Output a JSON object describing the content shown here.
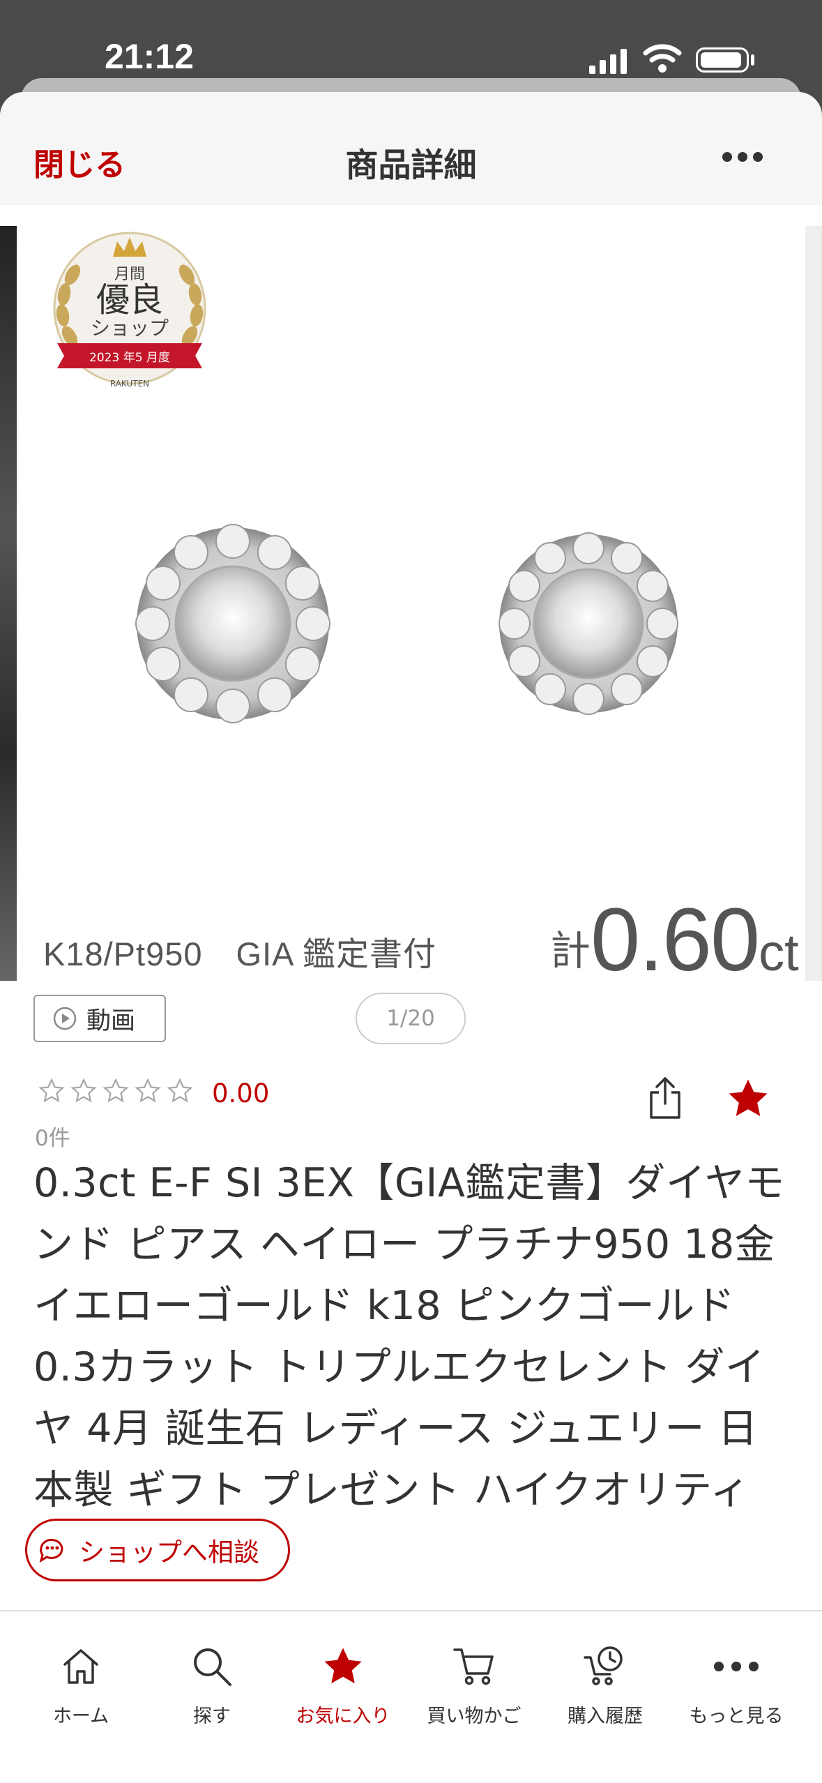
{
  "status": {
    "time": "21:12"
  },
  "header": {
    "close_label": "閉じる",
    "title": "商品詳細"
  },
  "gallery": {
    "spec_text": "K18/Pt950　GIA 鑑定書付",
    "carat_prefix": "計",
    "carat_value": "0.60",
    "carat_unit": "ct",
    "badge": {
      "line1": "月間",
      "line2": "優良",
      "line3": "ショップ",
      "ribbon": "2023 年5 月度",
      "footer": "RAKUTEN"
    },
    "video_label": "動画",
    "counter": "1/20"
  },
  "review": {
    "stars": 0,
    "rating": "0.00",
    "count": "0件"
  },
  "product": {
    "title": "0.3ct E-F SI 3EX【GIA鑑定書】ダイヤモンド ピアス ヘイロー プラチナ950 18金 イエローゴールド k18 ピンクゴールド 0.3カラット トリプルエクセレント ダイヤ 4月 誕生石 レディース ジュエリー 日本製 ギフト プレゼント ハイクオリティ 夏ギフト"
  },
  "chat": {
    "label": "ショップへ相談"
  },
  "tabs": [
    {
      "label": "ホーム",
      "icon": "home-icon"
    },
    {
      "label": "探す",
      "icon": "search-icon"
    },
    {
      "label": "お気に入り",
      "icon": "star-icon",
      "active": true
    },
    {
      "label": "買い物かご",
      "icon": "cart-icon"
    },
    {
      "label": "購入履歴",
      "icon": "history-icon"
    },
    {
      "label": "もっと見る",
      "icon": "more-icon"
    }
  ],
  "colors": {
    "brand": "#bf0000",
    "text": "#333333",
    "muted": "#999999"
  }
}
